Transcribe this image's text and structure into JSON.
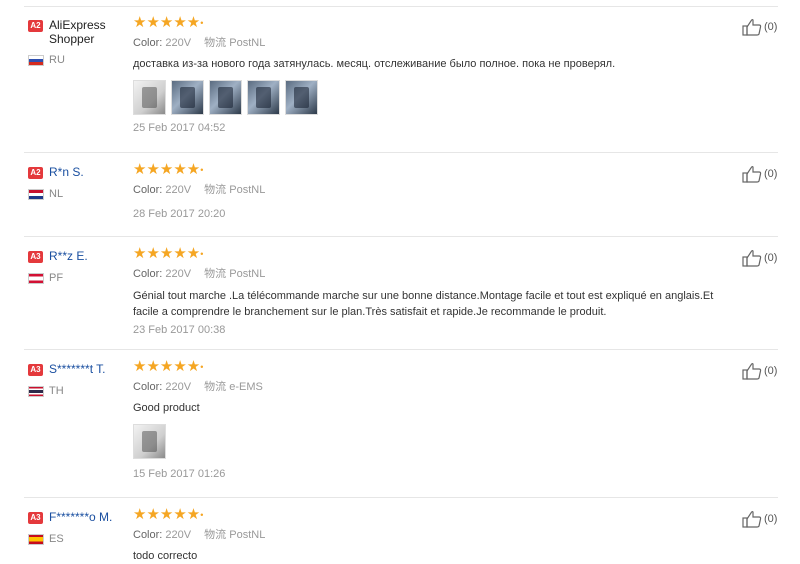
{
  "reviews": [
    {
      "badge": "A2",
      "user": "AliExpress Shopper",
      "country": "RU",
      "stars": "★★★★★",
      "color_label": "Color:",
      "color_value": "220V",
      "shipping_label": "物流",
      "shipping_value": "PostNL",
      "text": "доставка из-за нового года затянулась. месяц. отслеживание было полное. пока не проверял.",
      "date": "25 Feb 2017 04:52",
      "helpful": "(0)"
    },
    {
      "badge": "A2",
      "user": "R*n S.",
      "country": "NL",
      "stars": "★★★★★",
      "color_label": "Color:",
      "color_value": "220V",
      "shipping_label": "物流",
      "shipping_value": "PostNL",
      "text": "",
      "date": "28 Feb 2017 20:20",
      "helpful": "(0)"
    },
    {
      "badge": "A3",
      "user": "R**z E.",
      "country": "PF",
      "stars": "★★★★★",
      "color_label": "Color:",
      "color_value": "220V",
      "shipping_label": "物流",
      "shipping_value": "PostNL",
      "text_line1": "Génial tout marche .La télécommande marche sur une bonne distance.Montage facile et tout est expliqué en anglais.Et",
      "text_line2": "facile a comprendre le branchement sur le plan.Très satisfait et rapide.Je recommande le produit.",
      "date": "23 Feb 2017 00:38",
      "helpful": "(0)"
    },
    {
      "badge": "A3",
      "user": "S*******t T.",
      "country": "TH",
      "stars": "★★★★★",
      "color_label": "Color:",
      "color_value": "220V",
      "shipping_label": "物流",
      "shipping_value": "e-EMS",
      "text": "Good product",
      "date": "15 Feb 2017 01:26",
      "helpful": "(0)"
    },
    {
      "badge": "A3",
      "user": "F*******o M.",
      "country": "ES",
      "stars": "★★★★★",
      "color_label": "Color:",
      "color_value": "220V",
      "shipping_label": "物流",
      "shipping_value": "PostNL",
      "text": "todo correcto",
      "helpful": "(0)"
    }
  ],
  "colors": {
    "star": "#f5a623",
    "badge": "#e4393c",
    "link": "#1a4fa0"
  },
  "icons": {
    "helpful": "thumbs-up-icon"
  }
}
